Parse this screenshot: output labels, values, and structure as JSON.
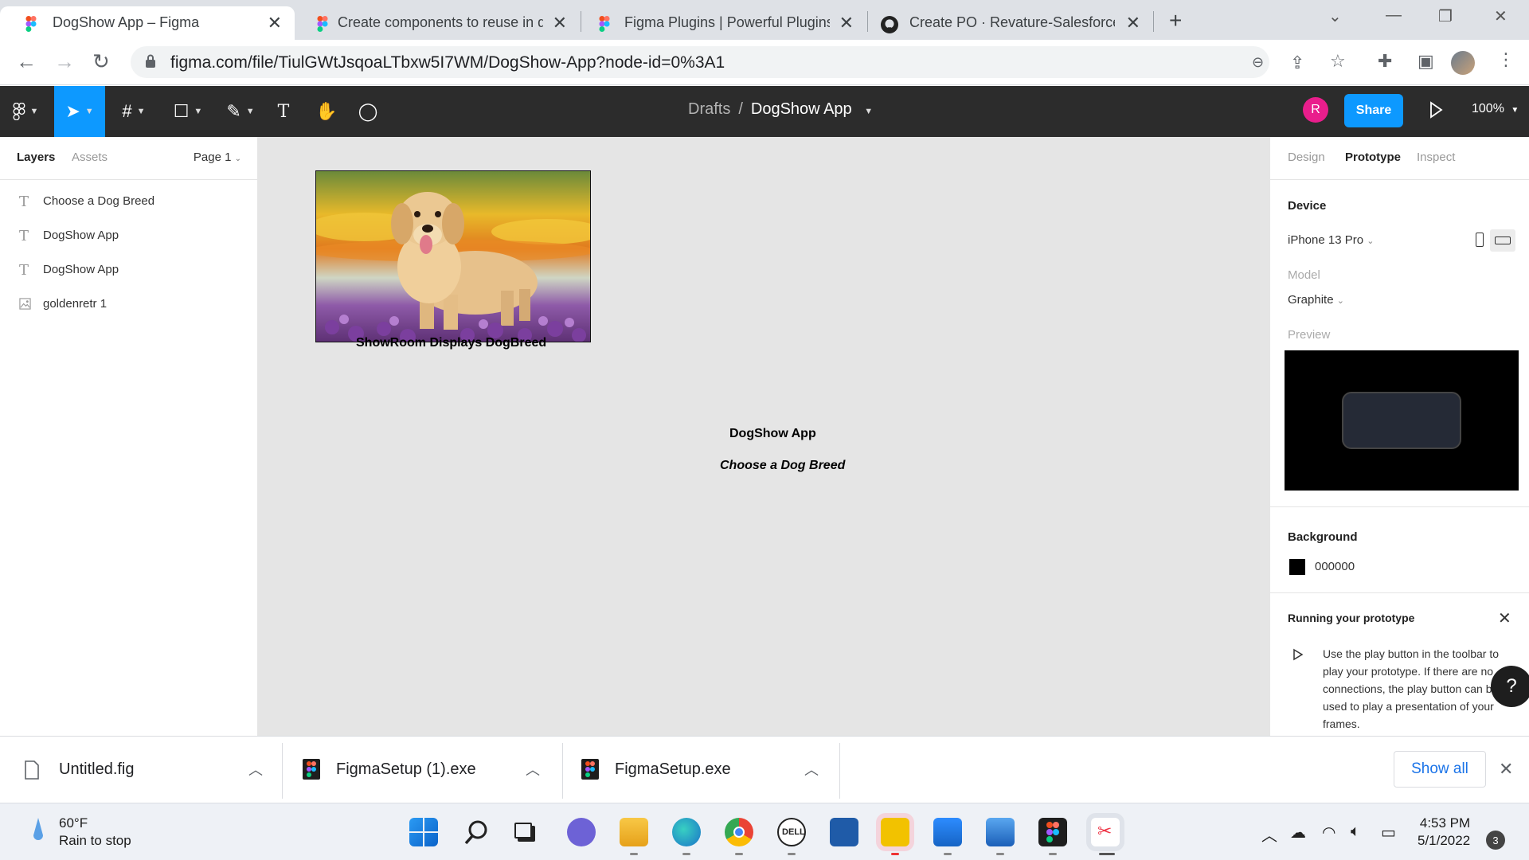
{
  "browser": {
    "tabs": [
      {
        "title": "DogShow App – Figma",
        "active": true
      },
      {
        "title": "Create components to reuse in d",
        "active": false
      },
      {
        "title": "Figma Plugins | Powerful Plugins",
        "active": false
      },
      {
        "title": "Create PO · Revature-Salesforce-",
        "active": false
      }
    ],
    "url": "figma.com/file/TiulGWtJsqoaLTbxw5I7WM/DogShow-App?node-id=0%3A1"
  },
  "figma": {
    "breadcrumb": {
      "folder": "Drafts",
      "separator": "/",
      "file": "DogShow App"
    },
    "avatar_initial": "R",
    "share_label": "Share",
    "zoom": "100%"
  },
  "left_panel": {
    "tabs": [
      "Layers",
      "Assets"
    ],
    "page": "Page 1",
    "layers": [
      {
        "name": "Choose a Dog Breed",
        "icon": "text-layer-icon"
      },
      {
        "name": "DogShow App",
        "icon": "text-layer-icon"
      },
      {
        "name": "DogShow App",
        "icon": "text-layer-icon"
      },
      {
        "name": "goldenretr 1",
        "icon": "image-layer-icon"
      }
    ]
  },
  "canvas": {
    "caption": "ShowRoom  Displays DogBreed",
    "app_title": "DogShow App",
    "subtitle": "Choose a Dog Breed"
  },
  "right_panel": {
    "tabs": [
      "Design",
      "Prototype",
      "Inspect"
    ],
    "device_label": "Device",
    "device_value": "iPhone 13 Pro",
    "model_label": "Model",
    "model_value": "Graphite",
    "preview_label": "Preview",
    "background_label": "Background",
    "background_value": "000000",
    "running_title": "Running your prototype",
    "running_text": "Use the play button in the toolbar to play your prototype. If there are no connections, the play button can be used to play a presentation of your frames.",
    "help": "?"
  },
  "downloads": {
    "items": [
      "Untitled.fig",
      "FigmaSetup (1).exe",
      "FigmaSetup.exe"
    ],
    "show_all": "Show all"
  },
  "taskbar": {
    "weather_temp": "60°F",
    "weather_desc": "Rain to stop",
    "time": "4:53 PM",
    "date": "5/1/2022",
    "notifications": "3"
  },
  "colors": {
    "figma_toolbar": "#2c2c2c",
    "figma_accent": "#0d99ff",
    "canvas_bg": "#e5e5e5",
    "avatar": "#e91e8c"
  }
}
